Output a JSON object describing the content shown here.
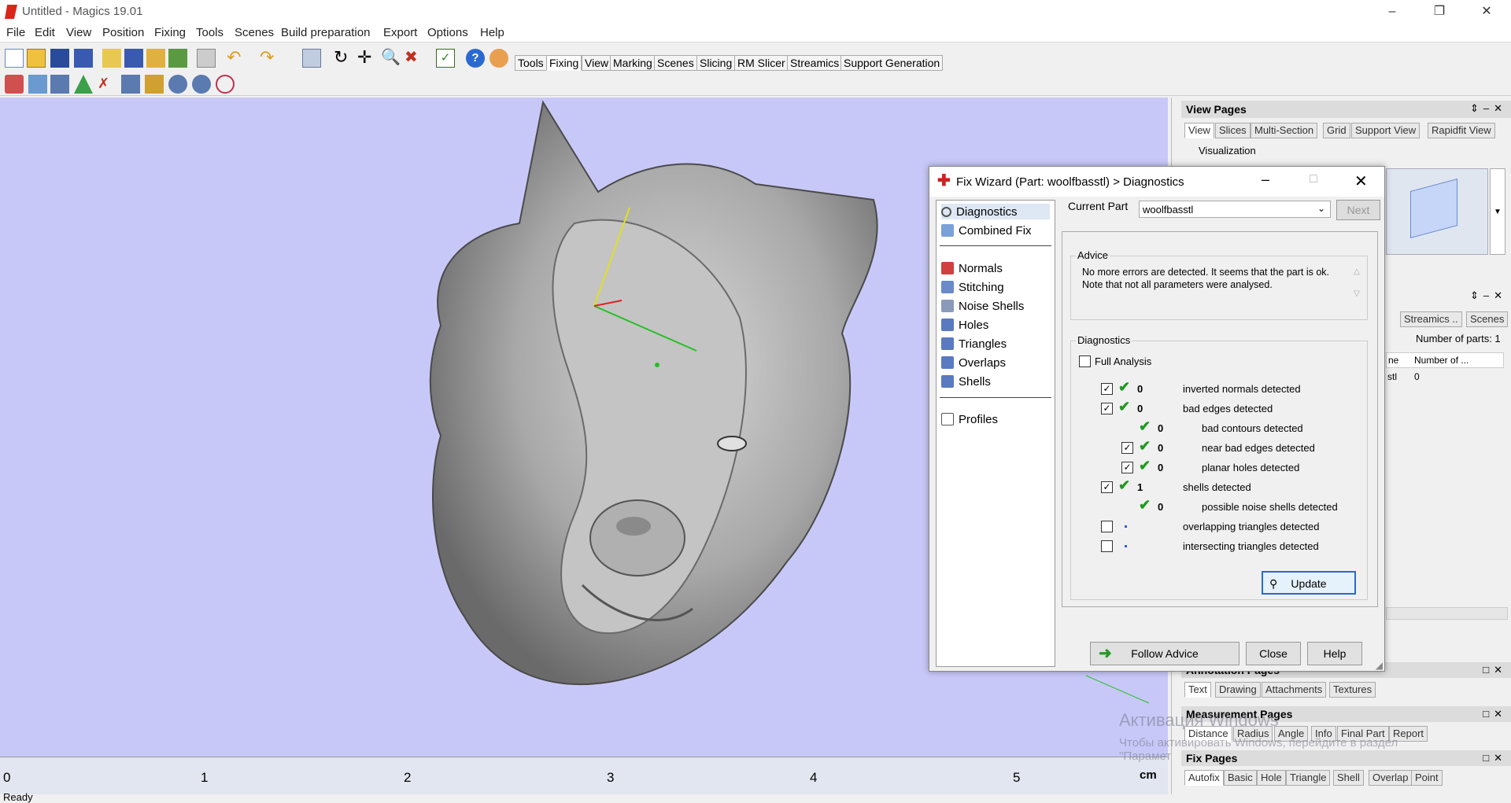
{
  "window": {
    "title": "Untitled - Magics 19.01"
  },
  "menu": [
    "File",
    "Edit",
    "View",
    "Position",
    "Fixing",
    "Tools",
    "Scenes",
    "Build preparation",
    "Export",
    "Options",
    "Help"
  ],
  "toolbar_tabs": [
    "Tools",
    "Fixing",
    "View",
    "Marking",
    "Scenes",
    "Slicing",
    "RM Slicer",
    "Streamics",
    "Support Generation"
  ],
  "active_toolbar_tab": "Fixing",
  "ruler": {
    "labels": [
      "0",
      "1",
      "2",
      "3",
      "4",
      "5"
    ],
    "unit": "cm"
  },
  "status": "Ready",
  "view_pages": {
    "title": "View Pages",
    "tabs": [
      "View",
      "Slices",
      "Multi-Section",
      "Grid",
      "Support View",
      "Rapidfit View"
    ],
    "visualization_label": "Visualization"
  },
  "parts_panel": {
    "tabs": [
      "Streamics ..",
      "Scenes"
    ],
    "count_label": "Number of parts: 1",
    "col_name": "ne",
    "col_number": "Number of ...",
    "row_name": "stl",
    "row_value": "0"
  },
  "annotation_pages": {
    "title": "Annotation Pages",
    "tabs": [
      "Text",
      "Drawing",
      "Attachments",
      "Textures"
    ]
  },
  "measurement_pages": {
    "title": "Measurement Pages",
    "tabs": [
      "Distance",
      "Radius",
      "Angle",
      "Info",
      "Final Part",
      "Report"
    ]
  },
  "fix_pages": {
    "title": "Fix Pages",
    "tabs": [
      "Autofix",
      "Basic",
      "Hole",
      "Triangle",
      "Shell",
      "Overlap",
      "Point"
    ]
  },
  "watermark": {
    "line1": "Активация Windows",
    "line2": "Чтобы активировать Windows, перейдите в раздел",
    "line3": "\"Парамет"
  },
  "dialog": {
    "title": "Fix Wizard (Part: woolfbasstl) > Diagnostics",
    "nav_top": [
      "Diagnostics",
      "Combined Fix"
    ],
    "nav_mid": [
      "Normals",
      "Stitching",
      "Noise Shells",
      "Holes",
      "Triangles",
      "Overlaps",
      "Shells"
    ],
    "nav_bottom": [
      "Profiles"
    ],
    "current_part_label": "Current Part",
    "current_part_value": "woolfbasstl",
    "next_label": "Next",
    "advice_title": "Advice",
    "advice_text": "No more errors are detected. It seems that the part is ok. Note that not all parameters were analysed.",
    "diagnostics_title": "Diagnostics",
    "full_analysis_label": "Full Analysis",
    "rows": [
      {
        "checked": true,
        "status": "ok",
        "value": "0",
        "label": "inverted normals detected",
        "indent": 0,
        "has_box": true
      },
      {
        "checked": true,
        "status": "ok",
        "value": "0",
        "label": "bad edges detected",
        "indent": 0,
        "has_box": true
      },
      {
        "checked": false,
        "status": "ok",
        "value": "0",
        "label": "bad contours detected",
        "indent": 1,
        "has_box": false
      },
      {
        "checked": true,
        "status": "ok",
        "value": "0",
        "label": "near bad edges detected",
        "indent": 1,
        "has_box": true
      },
      {
        "checked": true,
        "status": "ok",
        "value": "0",
        "label": "planar holes detected",
        "indent": 1,
        "has_box": true
      },
      {
        "checked": true,
        "status": "ok",
        "value": "1",
        "label": "shells detected",
        "indent": 0,
        "has_box": true
      },
      {
        "checked": false,
        "status": "ok",
        "value": "0",
        "label": "possible noise shells detected",
        "indent": 1,
        "has_box": false
      },
      {
        "checked": false,
        "status": "dot",
        "value": "",
        "label": "overlapping triangles detected",
        "indent": 0,
        "has_box": true
      },
      {
        "checked": false,
        "status": "dot",
        "value": "",
        "label": "intersecting triangles detected",
        "indent": 0,
        "has_box": true
      }
    ],
    "update_label": "Update",
    "follow_advice_label": "Follow Advice",
    "close_label": "Close",
    "help_label": "Help"
  }
}
